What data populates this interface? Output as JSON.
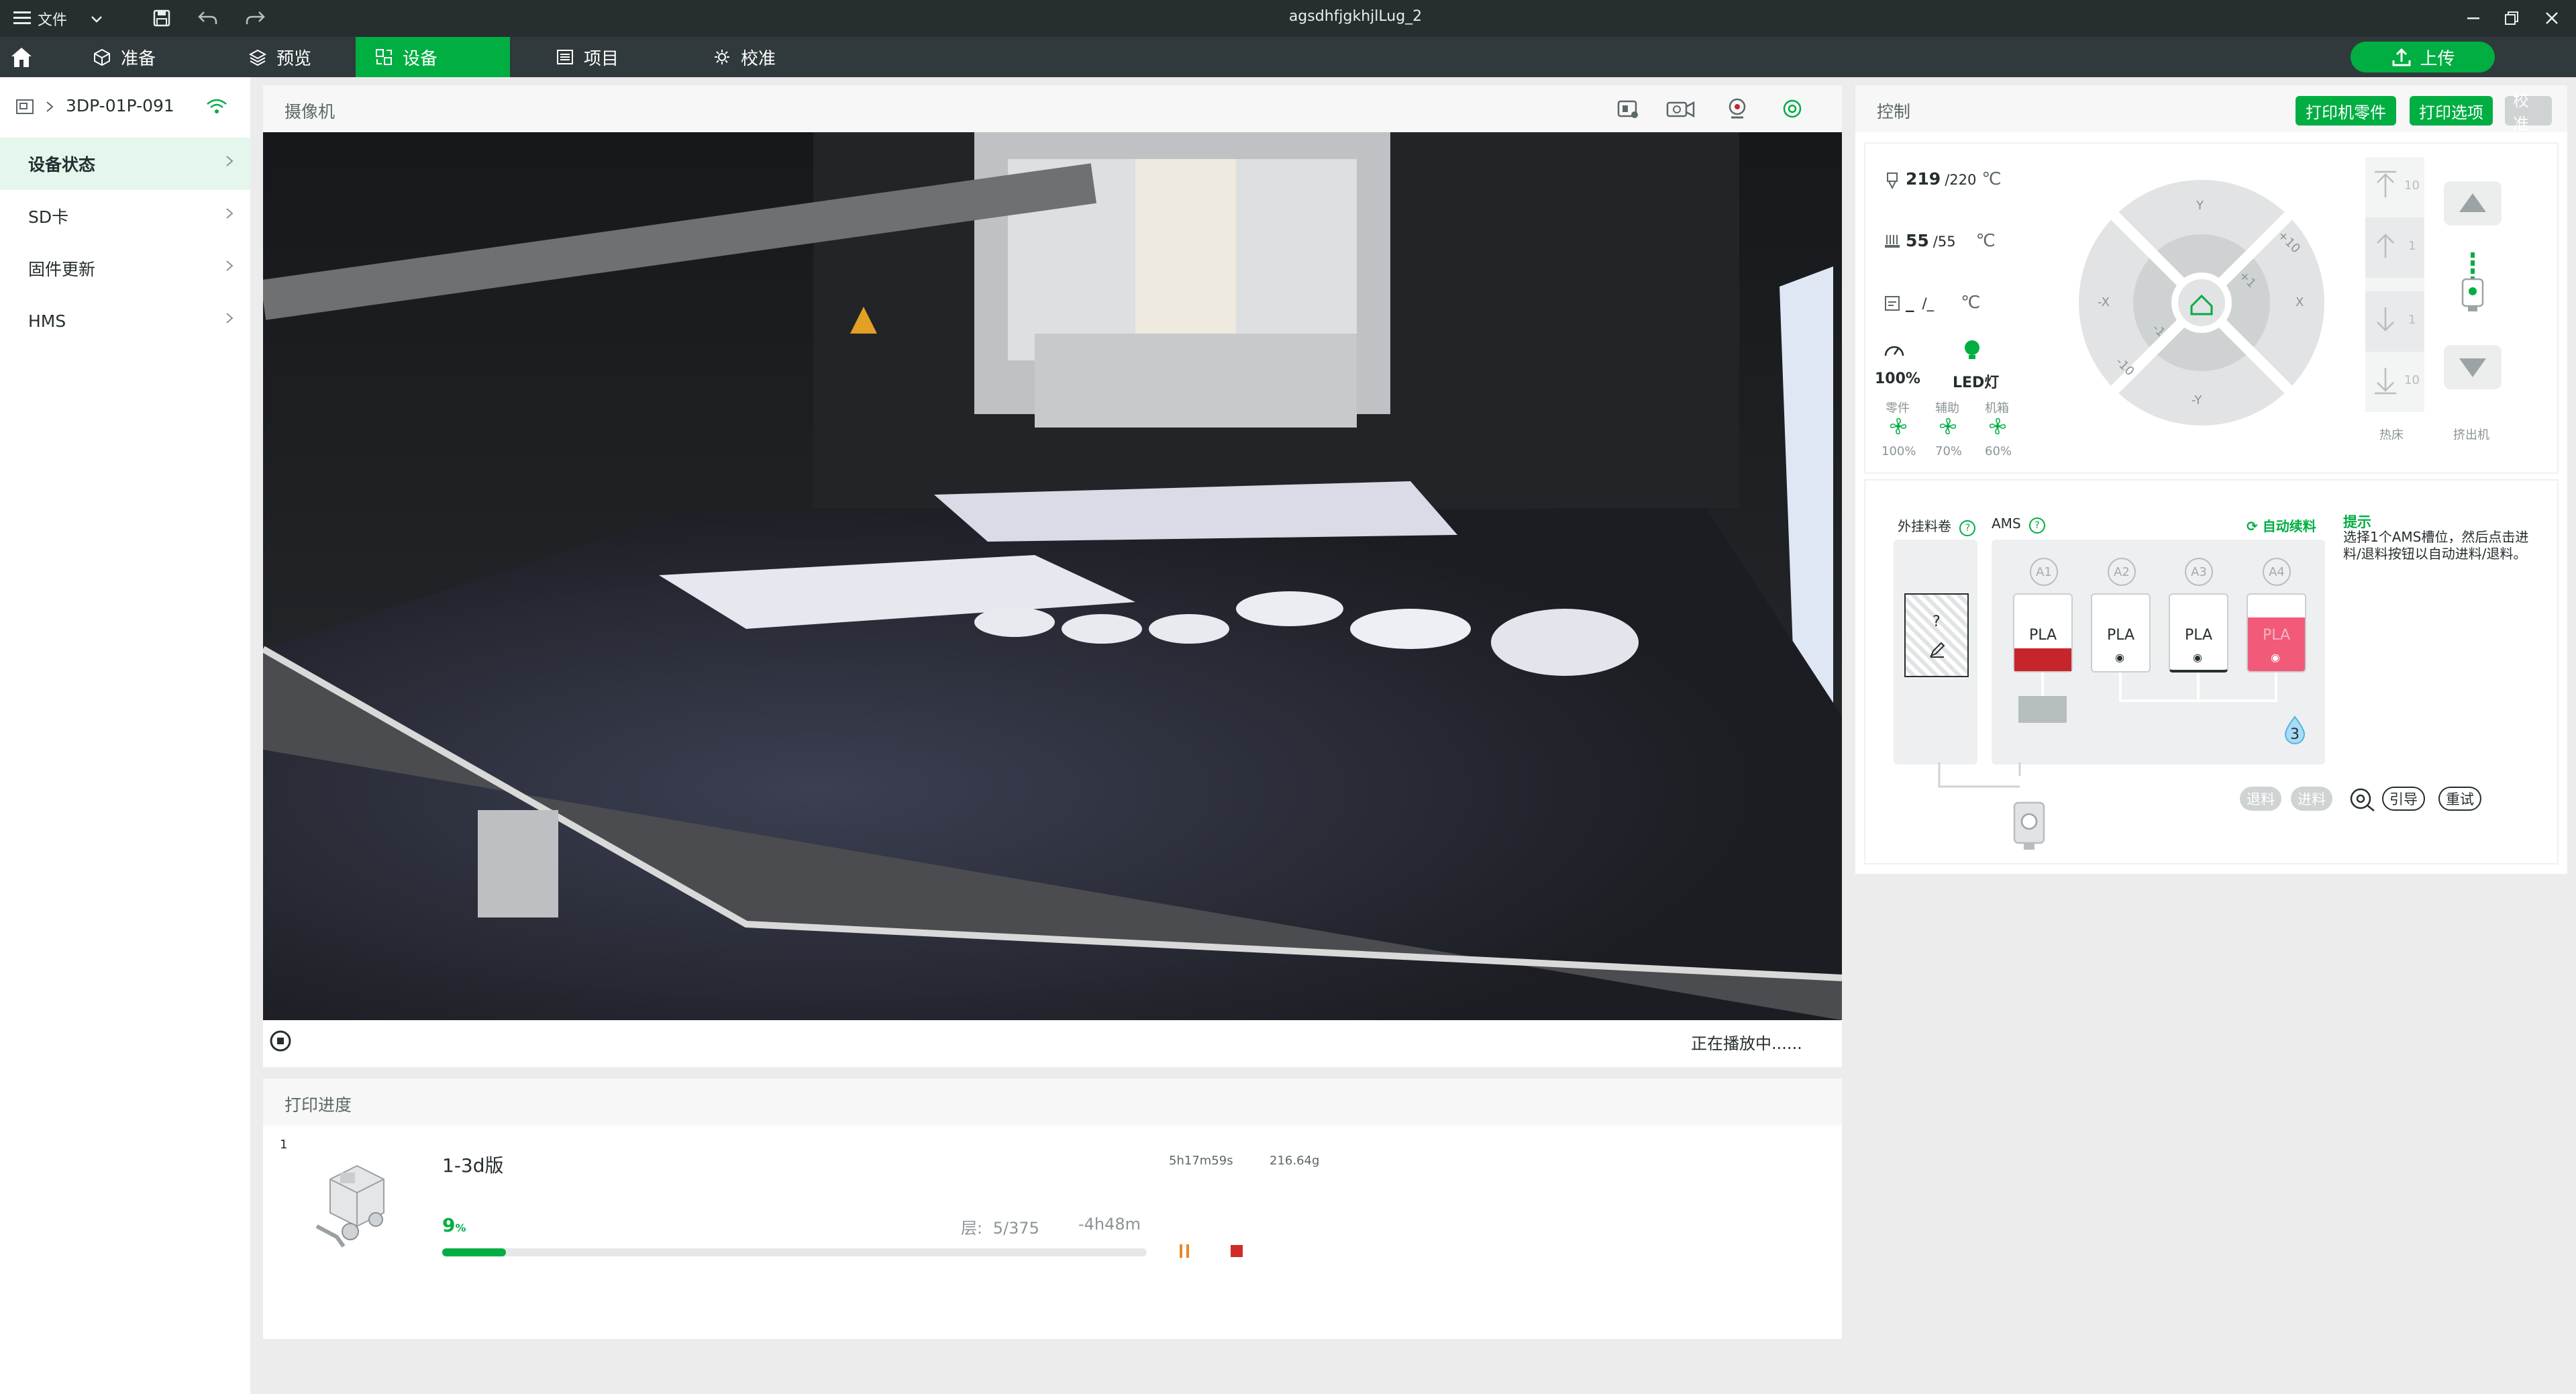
{
  "window": {
    "title": "agsdhfjgkhjlLug_2",
    "file_menu": "文件"
  },
  "nav": {
    "tabs": [
      {
        "label": "准备"
      },
      {
        "label": "预览"
      },
      {
        "label": "设备"
      },
      {
        "label": "项目"
      },
      {
        "label": "校准"
      }
    ],
    "upload_label": "上传"
  },
  "sidebar": {
    "device_name": "3DP-01P-091",
    "items": [
      {
        "label": "设备状态"
      },
      {
        "label": "SD卡"
      },
      {
        "label": "固件更新"
      },
      {
        "label": "HMS"
      }
    ]
  },
  "camera": {
    "title": "摄像机",
    "status": "正在播放中......"
  },
  "progress": {
    "title": "打印进度",
    "index": "1",
    "job_name": "1-3d版",
    "duration": "5h17m59s",
    "weight": "216.64g",
    "percent": "9",
    "percent_unit": "%",
    "percent_value": 9,
    "layer_label": "层:",
    "layer_value": "5/375",
    "remaining": "-4h48m"
  },
  "control": {
    "title": "控制",
    "btn_printer_parts": "打印机零件",
    "btn_print_options": "打印选项",
    "btn_calibrate": "校准",
    "nozzle_temp": "219",
    "nozzle_target": "/220",
    "bed_temp": "55",
    "bed_target": "/55",
    "chamber_temp": "_",
    "chamber_target": "/_",
    "unit_c": "℃",
    "speed": "100%",
    "led_label": "LED灯",
    "fans": [
      {
        "label": "零件",
        "value": "100%"
      },
      {
        "label": "辅助",
        "value": "70%"
      },
      {
        "label": "机箱",
        "value": "60%"
      }
    ],
    "jog": {
      "y_plus": "Y",
      "y_minus": "-Y",
      "x_plus": "X",
      "x_minus": "-X",
      "s10": "+10",
      "s1": "+1",
      "m1": "-1",
      "m10": "-10"
    },
    "bed_steps": [
      "10",
      "1",
      "1",
      "10"
    ],
    "bed_label": "热床",
    "extruder_label": "挤出机"
  },
  "ams": {
    "external_label": "外挂料卷",
    "external_question": "?",
    "ams_label": "AMS",
    "auto_refill": "自动续料",
    "hint_title": "提示",
    "hint_text": "选择1个AMS槽位，然后点击进料/退料按钮以自动进料/退料。",
    "slots": [
      {
        "id": "A1",
        "material": "PLA",
        "color": "#c6262b"
      },
      {
        "id": "A2",
        "material": "PLA",
        "color": "#ffffff"
      },
      {
        "id": "A3",
        "material": "PLA",
        "color": "#ffffff"
      },
      {
        "id": "A4",
        "material": "PLA",
        "color": "#f25a7a"
      }
    ],
    "humidity": "3",
    "btn_unload": "退料",
    "btn_load": "进料",
    "btn_guide": "引导",
    "btn_retry": "重试"
  }
}
